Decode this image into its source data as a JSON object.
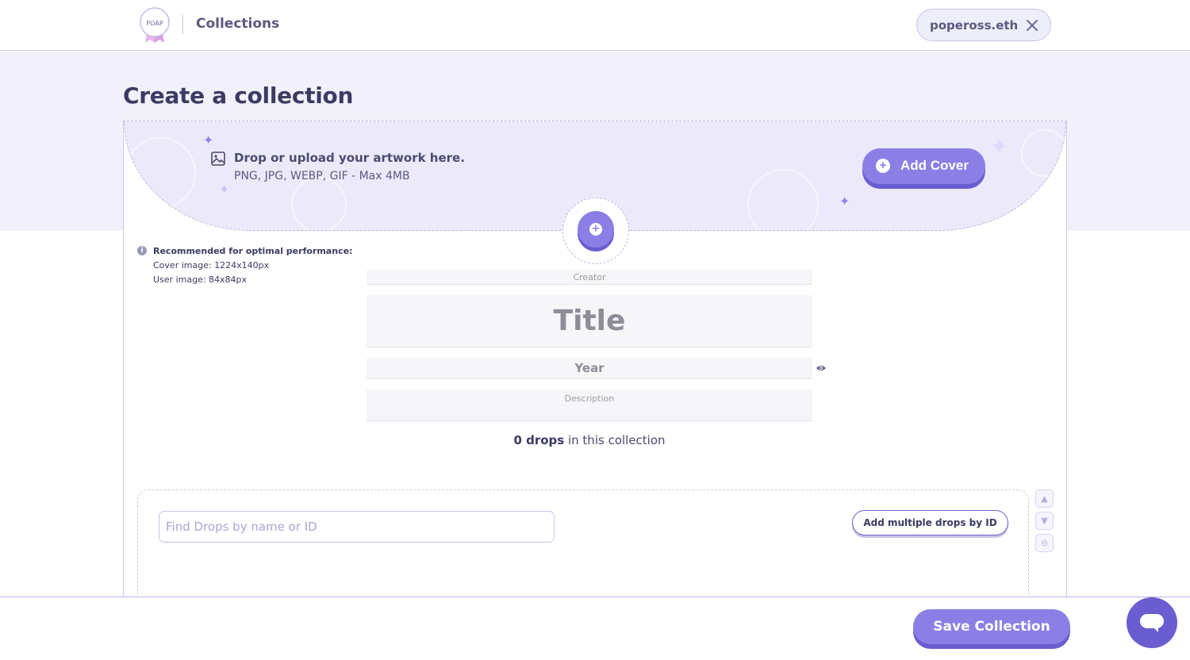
{
  "header": {
    "logo_text": "POAP",
    "nav_title": "Collections",
    "account_name": "popeross.eth"
  },
  "page": {
    "title": "Create a collection"
  },
  "cover": {
    "upload_title": "Drop or upload your artwork here.",
    "upload_sub": "PNG, JPG, WEBP, GIF - Max 4MB",
    "add_cover_label": "Add Cover"
  },
  "recommendation": {
    "title": "Recommended for optimal performance:",
    "cover_size": "Cover image: 1224x140px",
    "user_size": "User image: 84x84px"
  },
  "form": {
    "creator_placeholder": "Creator",
    "title_placeholder": "Title",
    "year_placeholder": "Year",
    "description_placeholder": "Description"
  },
  "drops": {
    "count": "0 drops",
    "count_suffix": " in this collection",
    "search_placeholder": "Find Drops by name or ID",
    "add_multiple_label": "Add multiple drops by ID"
  },
  "footer": {
    "save_label": "Save Collection"
  },
  "colors": {
    "accent": "#8b7fe6",
    "accent_dark": "#6a5dd0",
    "band": "#f2f1fb",
    "text_dark": "#3b3b63"
  }
}
